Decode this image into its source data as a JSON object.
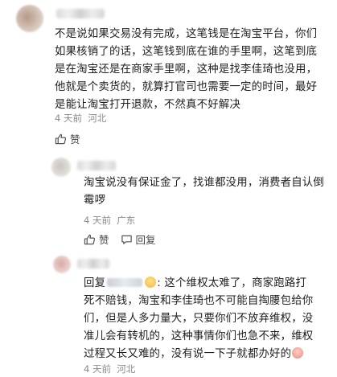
{
  "comments": [
    {
      "text": "不是说如果交易没有完成，这笔钱是在淘宝平台，你们如果核销了的话，这笔钱到底在谁的手里啊，这笔到底是在淘宝还是在商家手里啊，这种是找李佳琦也没用，他就是个卖货的，就算打官司也需要一定的时间，最好是能让淘宝打开退款，不然真不好解决",
      "time": "4 天前",
      "location": "河北",
      "like_label": "赞"
    },
    {
      "text": "淘宝说没有保证金了，找谁都没用，消费者自认倒霉啰",
      "time": "4 天前",
      "location": "广东",
      "like_label": "赞",
      "reply_label": "回复"
    },
    {
      "reply_prefix": "回复",
      "text": ": 这个维权太难了，商家跑路打死不赔钱，淘宝和李佳琦也不可能自掏腰包给你们，但是人多力量大，只要你们不放弃维权，没准儿会有转机的，这种事情你们也急不来，维权过程又长又难的，没有说一下子就都办好的",
      "time": "4 天前",
      "location": "河北"
    }
  ],
  "icons": {
    "like": "thumbs-up-icon",
    "reply": "speech-bubble-icon",
    "emoji_smile": "smiling-face-emoji",
    "emoji_sad": "sad-face-emoji"
  },
  "colors": {
    "meta": "#8a8a8a",
    "quote_name": "#3e5f8a"
  }
}
